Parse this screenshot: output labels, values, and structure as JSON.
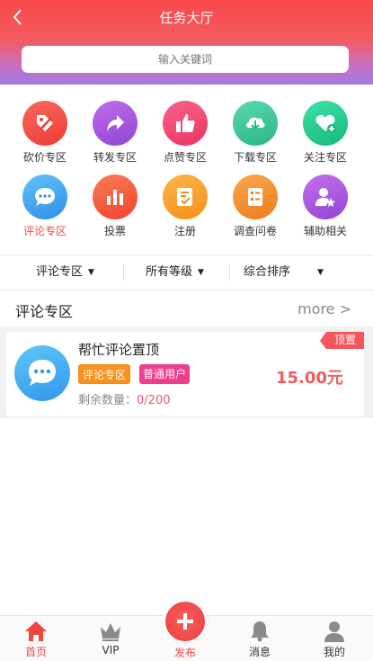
{
  "header": {
    "title": "任务大厅",
    "back_icon": "chevron-left-icon"
  },
  "search": {
    "placeholder": "输入关键词"
  },
  "categories": [
    {
      "label": "砍价专区",
      "icon": "tag-slash-icon",
      "color": "#f04b47"
    },
    {
      "label": "转发专区",
      "icon": "share-arrow-icon",
      "color": "#a457d9"
    },
    {
      "label": "点赞专区",
      "icon": "thumbs-up-icon",
      "color": "#f0446c"
    },
    {
      "label": "下载专区",
      "icon": "cloud-download-icon",
      "color": "#3cc79a"
    },
    {
      "label": "关注专区",
      "icon": "heart-plus-icon",
      "color": "#21c68c"
    },
    {
      "label": "评论专区",
      "icon": "chat-bubble-icon",
      "color": "#3fa6ef",
      "active": true
    },
    {
      "label": "投票",
      "icon": "bar-chart-icon",
      "color": "#f3553d"
    },
    {
      "label": "注册",
      "icon": "edit-form-icon",
      "color": "#f59f26"
    },
    {
      "label": "调查问卷",
      "icon": "survey-icon",
      "color": "#f28c23"
    },
    {
      "label": "辅助相关",
      "icon": "user-star-icon",
      "color": "#a555dc"
    }
  ],
  "filters": [
    {
      "label": "评论专区"
    },
    {
      "label": "所有等级"
    },
    {
      "label": "综合排序"
    }
  ],
  "section": {
    "title": "评论专区",
    "more": "more >"
  },
  "task": {
    "title": "帮忙评论置顶",
    "tags": [
      "评论专区",
      "普通用户"
    ],
    "remaining_label": "剩余数量：",
    "remaining_value": "0/200",
    "price": "15.00元",
    "ribbon": "顶置"
  },
  "tabbar": [
    {
      "label": "首页",
      "icon": "home-icon",
      "active": true
    },
    {
      "label": "VIP",
      "icon": "crown-icon"
    },
    {
      "label": "发布",
      "icon": "plus-icon"
    },
    {
      "label": "消息",
      "icon": "bell-icon"
    },
    {
      "label": "我的",
      "icon": "user-icon"
    }
  ],
  "colors": {
    "brand": "#f8494a",
    "accent_pink": "#ee3f8f",
    "accent_orange": "#f8921e"
  }
}
